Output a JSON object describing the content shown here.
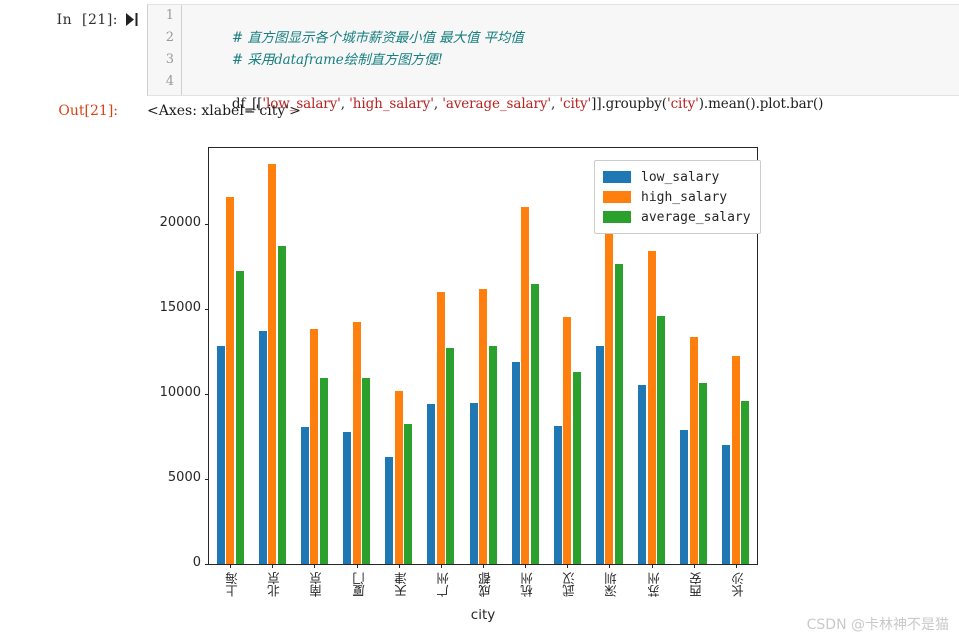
{
  "notebook": {
    "input_prompt": "In  [21]:",
    "run_icon": "run-cell-icon",
    "output_prompt": "Out[21]:",
    "output_repr": "<Axes: xlabel='city'>",
    "line_numbers": [
      "1",
      "2",
      "3",
      "4"
    ],
    "code": {
      "line1_comment": "# 直方图显示各个城市薪资最小值 最大值 平均值",
      "line2_comment": "# 采用dataframe绘制直方图方便!",
      "line3": "",
      "line4_a": "df_[[",
      "line4_s1": "'low_salary'",
      "line4_b": ", ",
      "line4_s2": "'high_salary'",
      "line4_c": ", ",
      "line4_s3": "'average_salary'",
      "line4_d": ", ",
      "line4_s4": "'city'",
      "line4_e": "]].groupby(",
      "line4_s5": "'city'",
      "line4_f": ").mean().plot.bar()"
    }
  },
  "watermark": "CSDN @卡林神不是猫",
  "chart_data": {
    "type": "bar",
    "title": "",
    "xlabel": "city",
    "ylabel": "",
    "ylim": [
      0,
      24500
    ],
    "yticks": [
      0,
      5000,
      10000,
      15000,
      20000
    ],
    "ytick_labels": [
      "0",
      "5000",
      "10000",
      "15000",
      "20000"
    ],
    "grid": false,
    "legend_position": "upper right",
    "categories": [
      "上海",
      "北京",
      "南京",
      "厦门",
      "天津",
      "广州",
      "成都",
      "杭州",
      "武汉",
      "深圳",
      "苏州",
      "西安",
      "长沙"
    ],
    "colors": {
      "low_salary": "#1f77b4",
      "high_salary": "#ff7f0e",
      "average_salary": "#2ca02c"
    },
    "series": [
      {
        "name": "low_salary",
        "values": [
          12850,
          13700,
          8050,
          7750,
          6300,
          9400,
          9500,
          11900,
          8100,
          12850,
          10550,
          7900,
          7000
        ]
      },
      {
        "name": "high_salary",
        "values": [
          21600,
          23550,
          13850,
          14250,
          10200,
          16000,
          16200,
          21050,
          14550,
          23000,
          18450,
          13350,
          12250
        ]
      },
      {
        "name": "average_salary",
        "values": [
          17250,
          18700,
          10950,
          10950,
          8250,
          12750,
          12850,
          16500,
          11300,
          17650,
          14600,
          10650,
          9600
        ]
      }
    ]
  }
}
